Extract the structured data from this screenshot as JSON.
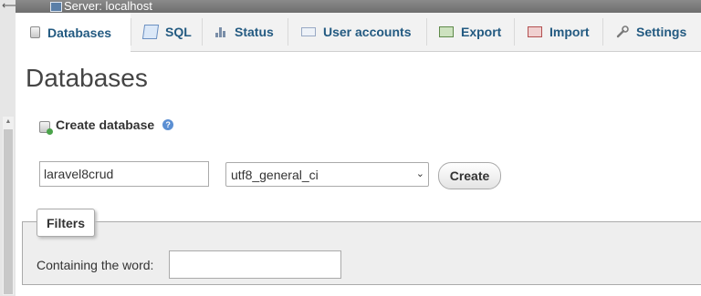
{
  "server": {
    "label": "Server: localhost"
  },
  "tabs": [
    {
      "label": "Databases",
      "icon": "database-icon",
      "active": true
    },
    {
      "label": "SQL",
      "icon": "sql-icon"
    },
    {
      "label": "Status",
      "icon": "status-icon"
    },
    {
      "label": "User accounts",
      "icon": "user-accounts-icon"
    },
    {
      "label": "Export",
      "icon": "export-icon"
    },
    {
      "label": "Import",
      "icon": "import-icon"
    },
    {
      "label": "Settings",
      "icon": "settings-icon"
    }
  ],
  "page": {
    "title": "Databases"
  },
  "create_db": {
    "heading": "Create database",
    "help_icon": "help-icon",
    "db_name_value": "laravel8crud",
    "collation_value": "utf8_general_ci",
    "create_button": "Create"
  },
  "filters": {
    "legend": "Filters",
    "label": "Containing the word:",
    "input_value": ""
  },
  "colors": {
    "tab_text": "#235a81",
    "server_bar": "#7a7a7a"
  }
}
